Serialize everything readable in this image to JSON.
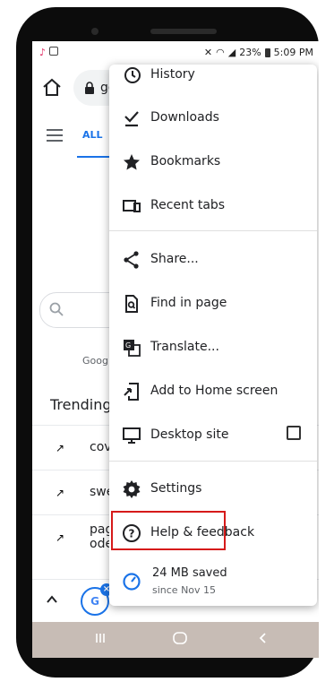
{
  "status_bar": {
    "battery": "23%",
    "time": "5:09 PM"
  },
  "toolbar": {
    "url_text": "go"
  },
  "background_page": {
    "tab_all": "ALL",
    "google_text": "Googl",
    "trending_heading": "Trending",
    "trending_items": [
      "cov",
      "swe",
      "pag\node"
    ]
  },
  "menu": {
    "items": [
      {
        "label": "History",
        "icon": "history-icon"
      },
      {
        "label": "Downloads",
        "icon": "downloads-icon"
      },
      {
        "label": "Bookmarks",
        "icon": "bookmark-star-icon"
      },
      {
        "label": "Recent tabs",
        "icon": "recent-tabs-icon"
      },
      {
        "label": "Share...",
        "icon": "share-icon"
      },
      {
        "label": "Find in page",
        "icon": "find-in-page-icon"
      },
      {
        "label": "Translate...",
        "icon": "translate-icon"
      },
      {
        "label": "Add to Home screen",
        "icon": "add-to-home-icon"
      },
      {
        "label": "Desktop site",
        "icon": "desktop-icon",
        "checked": false
      },
      {
        "label": "Settings",
        "icon": "gear-icon"
      },
      {
        "label": "Help & feedback",
        "icon": "help-icon"
      }
    ],
    "data_saver": {
      "title": "24 MB saved",
      "subtitle": "since Nov 15"
    }
  },
  "colors": {
    "accent": "#1a73e8",
    "highlight_border": "#d61a1a",
    "nav_bar": "#c7bcb5"
  }
}
